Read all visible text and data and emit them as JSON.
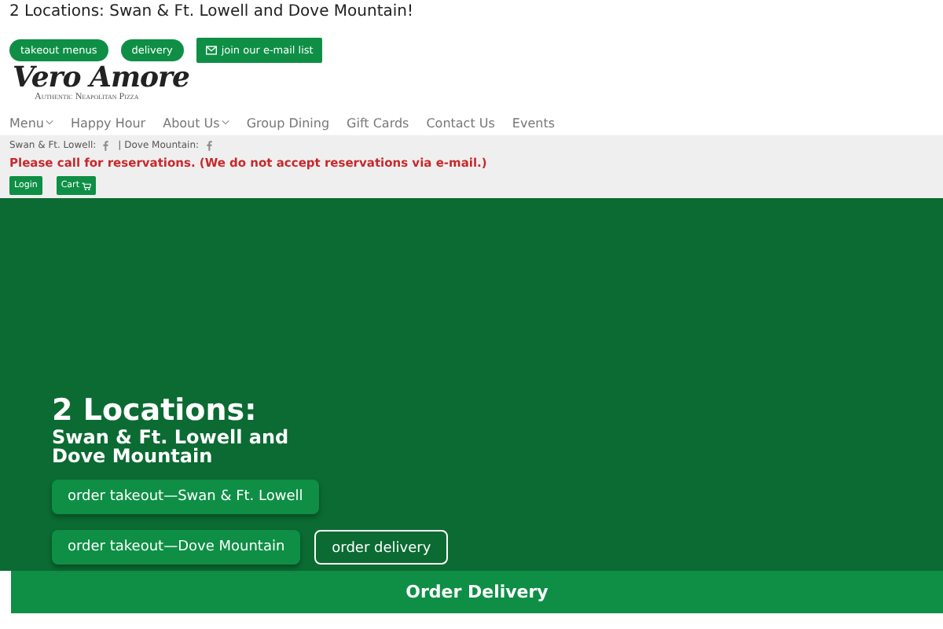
{
  "announcement": "2 Locations: Swan & Ft. Lowell and Dove Mountain!",
  "top_buttons": [
    {
      "label": "takeout menus",
      "kind": "pill"
    },
    {
      "label": "delivery",
      "kind": "pill"
    },
    {
      "label": "join our e-mail list",
      "kind": "mail"
    }
  ],
  "logo": {
    "name": "Vero Amore",
    "tagline": "Authentic Neapolitan Pizza"
  },
  "nav": [
    {
      "label": "Menu",
      "dropdown": true
    },
    {
      "label": "Happy Hour",
      "dropdown": false
    },
    {
      "label": "About Us",
      "dropdown": true
    },
    {
      "label": "Group Dining",
      "dropdown": false
    },
    {
      "label": "Gift Cards",
      "dropdown": false
    },
    {
      "label": "Contact Us",
      "dropdown": false
    },
    {
      "label": "Events",
      "dropdown": false
    }
  ],
  "social": [
    {
      "label": "Swan & Ft. Lowell:"
    },
    {
      "label": "| Dove Mountain:"
    }
  ],
  "notice": "Please call for reservations. (We do not accept reservations via e-mail.)",
  "account_buttons": [
    {
      "label": "Login",
      "kind": "plain"
    },
    {
      "label": "Cart",
      "kind": "cart"
    }
  ],
  "hero": {
    "title": "2 Locations:",
    "subtitle": "Swan & Ft. Lowell and Dove Mountain",
    "buttons": [
      {
        "label": "order takeout—Swan & Ft. Lowell",
        "kind": "solid"
      },
      {
        "label": "order takeout—Dove Mountain",
        "kind": "solid"
      },
      {
        "label": "order delivery",
        "kind": "outline"
      }
    ]
  },
  "delivery_bar": "Order Delivery"
}
